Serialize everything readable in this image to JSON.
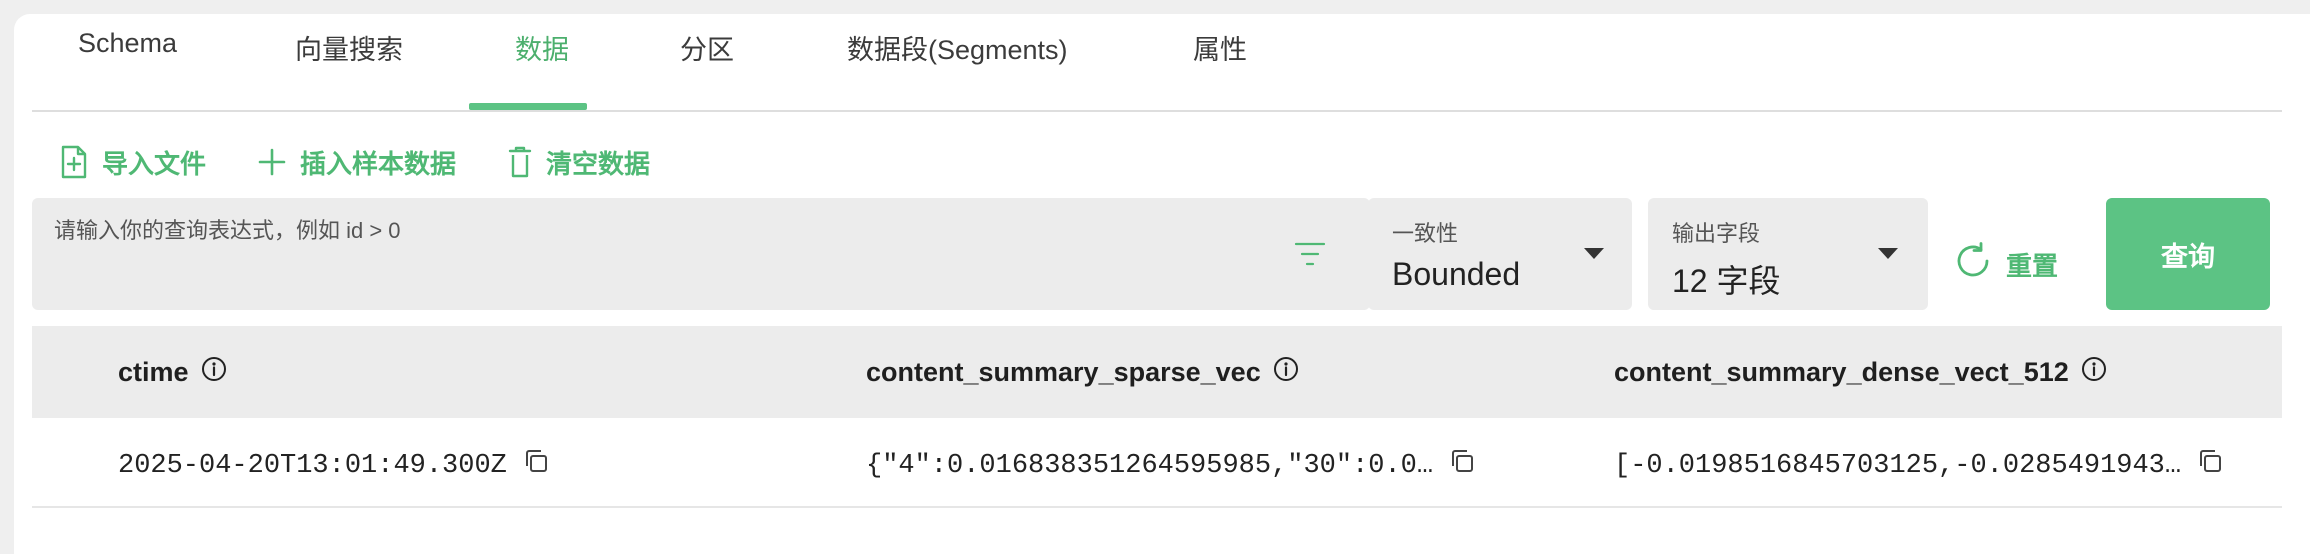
{
  "tabs": [
    {
      "label": "Schema",
      "active": false
    },
    {
      "label": "向量搜索",
      "active": false
    },
    {
      "label": "数据",
      "active": true
    },
    {
      "label": "分区",
      "active": false
    },
    {
      "label": "数据段(Segments)",
      "active": false
    },
    {
      "label": "属性",
      "active": false
    }
  ],
  "actions": {
    "import_label": "导入文件",
    "insert_label": "插入样本数据",
    "clear_label": "清空数据"
  },
  "query": {
    "placeholder": "请输入你的查询表达式，例如 id > 0",
    "value": ""
  },
  "consistency": {
    "label": "一致性",
    "value": "Bounded"
  },
  "output_fields": {
    "label": "输出字段",
    "value": "12 字段"
  },
  "buttons": {
    "reset_label": "重置",
    "query_label": "查询"
  },
  "table": {
    "columns": [
      "ctime",
      "content_summary_sparse_vec",
      "content_summary_dense_vect_512"
    ],
    "rows": [
      [
        "2025-04-20T13:01:49.300Z",
        "{\"4\":0.016838351264595985,\"30\":0.0…",
        "[-0.0198516845703125,-0.0285491943…"
      ]
    ]
  },
  "colors": {
    "accent": "#5cc384",
    "accent_text": "#4fb874",
    "field_bg": "#ececec"
  }
}
